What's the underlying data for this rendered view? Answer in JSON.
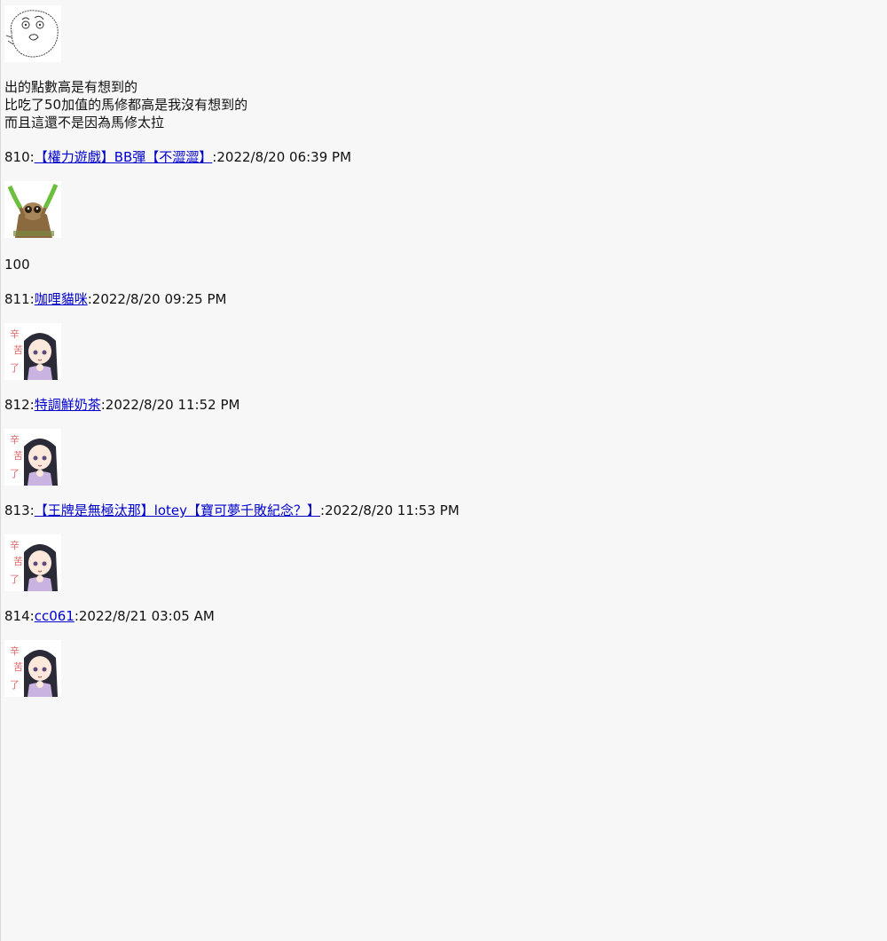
{
  "intro": {
    "lines": [
      "出的點數高是有想到的",
      "比吃了50加值的馬修都高是我沒有想到的",
      "而且這還不是因為馬修太拉"
    ]
  },
  "posts": [
    {
      "number": "810",
      "author": "【權力遊戲】BB彈【不澀澀】",
      "timestamp": "2022/8/20 06:39 PM",
      "sticker": "loris-holding-leaves-sticker",
      "body": "100"
    },
    {
      "number": "811",
      "author": "咖哩貓咪",
      "timestamp": "2022/8/20 09:25 PM",
      "sticker": "anime-girl-thanks-sticker",
      "sticker_text": "辛苦了"
    },
    {
      "number": "812",
      "author": "特調鮮奶茶",
      "timestamp": "2022/8/20 11:52 PM",
      "sticker": "anime-girl-thanks-sticker",
      "sticker_text": "辛苦了"
    },
    {
      "number": "813",
      "author": "【王牌是無極汰那】lotey【寶可夢千敗紀念？】",
      "timestamp": "2022/8/20 11:53 PM",
      "sticker": "anime-girl-thanks-sticker",
      "sticker_text": "辛苦了"
    },
    {
      "number": "814",
      "author": "cc061",
      "timestamp": "2022/8/21 03:05 AM",
      "sticker": "anime-girl-thanks-sticker",
      "sticker_text": "辛苦了"
    }
  ],
  "separator": ":"
}
